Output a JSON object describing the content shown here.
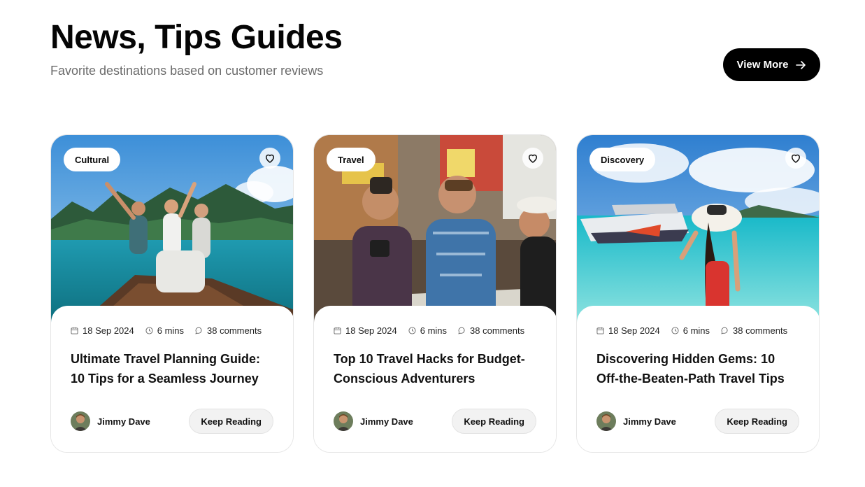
{
  "header": {
    "title": "News, Tips Guides",
    "subtitle": "Favorite destinations based on customer reviews",
    "view_more_label": "View More"
  },
  "icons": {
    "view_more": "arrow-right-icon",
    "favorite": "heart-icon",
    "date": "calendar-icon",
    "duration": "clock-icon",
    "comments": "comment-icon"
  },
  "cards": [
    {
      "tag": "Cultural",
      "date": "18 Sep 2024",
      "read_time": "6 mins",
      "comments": "38 comments",
      "title": "Ultimate Travel Planning Guide: 10 Tips for a Seamless Journey",
      "author": "Jimmy Dave",
      "cta": "Keep Reading"
    },
    {
      "tag": "Travel",
      "date": "18 Sep 2024",
      "read_time": "6 mins",
      "comments": "38 comments",
      "title": "Top 10 Travel Hacks for Budget-Conscious Adventurers",
      "author": "Jimmy Dave",
      "cta": "Keep Reading"
    },
    {
      "tag": "Discovery",
      "date": "18 Sep 2024",
      "read_time": "6 mins",
      "comments": "38 comments",
      "title": "Discovering Hidden Gems: 10 Off-the-Beaten-Path Travel Tips",
      "author": "Jimmy Dave",
      "cta": "Keep Reading"
    }
  ]
}
